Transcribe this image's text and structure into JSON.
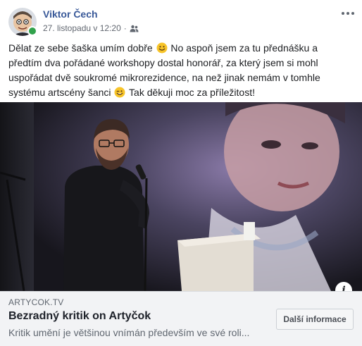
{
  "post": {
    "author": "Viktor Čech",
    "timestamp": "27. listopadu v 12:20",
    "separator": "·",
    "audience_icon": "friends-icon",
    "online": true,
    "more_icon": "more-options-icon",
    "text": {
      "part1": "Dělat ze sebe šaška umím dobře ",
      "part2": " No aspoň jsem za tu přednášku a předtím dva pořádané workshopy dostal honorář, za který jsem si mohl uspořádat dvě soukromé mikrorezidence, na než jinak nemám v tomhle systému artscény šanci ",
      "part3": " Tak děkuji moc za příležitost!"
    },
    "emojis": [
      "smiling-emoji",
      "winking-emoji"
    ]
  },
  "link_preview": {
    "domain": "ARTYCOK.TV",
    "title": "Bezradný kritik on Artyčok",
    "description": "Kritik umění je většinou vnímán především ve své roli...",
    "button_label": "Další informace",
    "info_icon": "info-icon",
    "info_label": "i"
  },
  "colors": {
    "author_link": "#385898",
    "meta_text": "#616770",
    "online": "#31a24c",
    "link_box_bg": "#f2f3f5"
  }
}
